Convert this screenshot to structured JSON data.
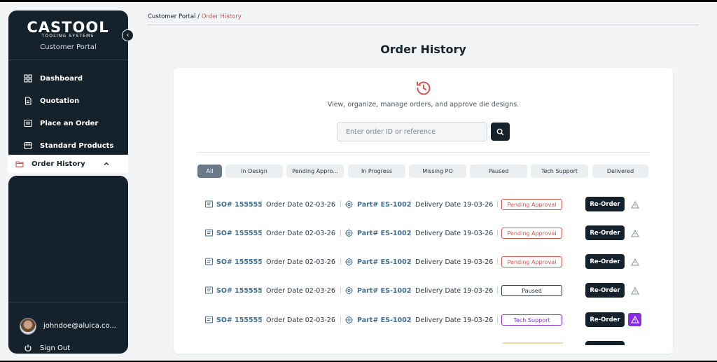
{
  "brand": {
    "name": "CASTOOL",
    "tagline": "TOOLING SYSTEMS",
    "portal": "Customer Portal"
  },
  "sidebar": {
    "items": [
      {
        "label": "Dashboard",
        "icon": "dashboard-icon"
      },
      {
        "label": "Quotation",
        "icon": "document-icon"
      },
      {
        "label": "Place an Order",
        "icon": "list-icon"
      },
      {
        "label": "Standard Products",
        "icon": "box-icon"
      },
      {
        "label": "Order History",
        "icon": "folder-icon",
        "active": true
      }
    ],
    "user_email": "johndoe@aluica.co...",
    "sign_out": "Sign Out"
  },
  "breadcrumb": {
    "root": "Customer Portal",
    "separator": "/",
    "current": "Order History"
  },
  "page": {
    "title": "Order History",
    "subtitle": "View, organize, manage orders, and approve die designs.",
    "search_placeholder": "Enter order ID or reference"
  },
  "filters": [
    "All",
    "In Design",
    "Pending Appro...",
    "In Progress",
    "Missing PO",
    "Paused",
    "Tech Support",
    "Delivered"
  ],
  "orders": [
    {
      "so": "SO# 155555",
      "order_date": "Order Date 02-03-26",
      "part": "Part# ES-1002",
      "delivery_date": "Delivery Date 19-03-26",
      "status": "Pending Approval",
      "action": "Re-Order"
    },
    {
      "so": "SO# 155555",
      "order_date": "Order Date 02-03-26",
      "part": "Part# ES-1002",
      "delivery_date": "Delivery Date 19-03-26",
      "status": "Pending Approval",
      "action": "Re-Order"
    },
    {
      "so": "SO# 155555",
      "order_date": "Order Date 02-03-26",
      "part": "Part# ES-1002",
      "delivery_date": "Delivery Date 19-03-26",
      "status": "Pending Approval",
      "action": "Re-Order"
    },
    {
      "so": "SO# 155555",
      "order_date": "Order Date 02-03-26",
      "part": "Part# ES-1002",
      "delivery_date": "Delivery Date 19-03-26",
      "status": "Paused",
      "action": "Re-Order"
    },
    {
      "so": "SO# 155555",
      "order_date": "Order Date 02-03-26",
      "part": "Part# ES-1002",
      "delivery_date": "Delivery Date 19-03-26",
      "status": "Tech Support",
      "action": "Re-Order"
    }
  ],
  "colors": {
    "sidebar": "#15212b",
    "accent": "#d4574d",
    "link": "#3f6f93",
    "status_pending": "#d4574d",
    "status_paused": "#2b3640",
    "status_tech": "#8a2be2"
  }
}
